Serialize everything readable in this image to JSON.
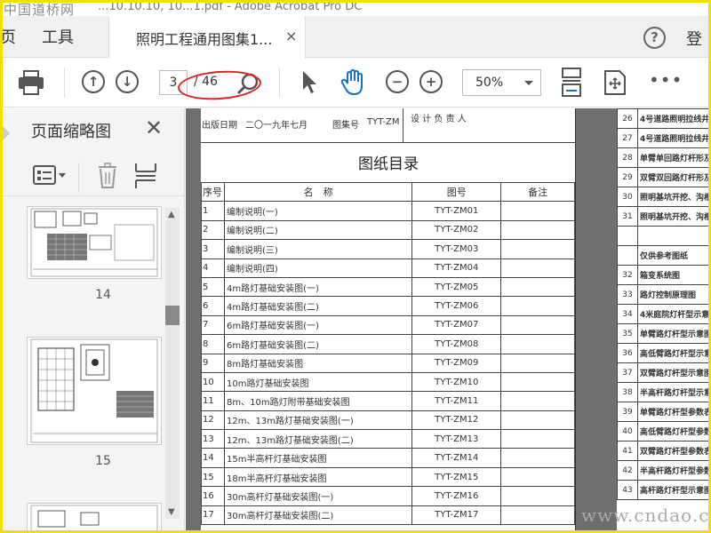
{
  "window": {
    "watermark": "中国道桥网",
    "title": "...10.10.10, 10...1.pdf - Adobe Acrobat Pro DC"
  },
  "tabbar": {
    "home_label": "页",
    "tools_label": "工具",
    "doc_tab_label": "照明工程通用图集1...",
    "close_glyph": "×",
    "help_glyph": "?",
    "login_label": "登"
  },
  "toolbar": {
    "current_page": "3",
    "total_pages": "/ 46",
    "zoom_value": "50%",
    "more_glyph": "•••"
  },
  "thumbnail_panel": {
    "title": "页面缩略图",
    "close_glyph": "✕",
    "pages": [
      "14",
      "15"
    ]
  },
  "document": {
    "header_date_label": "出版日期",
    "header_date": "二〇一九年七月",
    "header_atlas_label": "图集号",
    "header_atlas_no": "TYT-ZM",
    "header_designer": "设 计 负 责 人",
    "title": "图纸目录",
    "columns": [
      "序号",
      "名　称",
      "图号",
      "备注"
    ],
    "rows": [
      {
        "no": "1",
        "name": "编制说明(一)",
        "code": "TYT-ZM01"
      },
      {
        "no": "2",
        "name": "编制说明(二)",
        "code": "TYT-ZM02"
      },
      {
        "no": "3",
        "name": "编制说明(三)",
        "code": "TYT-ZM03"
      },
      {
        "no": "4",
        "name": "编制说明(四)",
        "code": "TYT-ZM04"
      },
      {
        "no": "5",
        "name": "4m路灯基础安装图(一)",
        "code": "TYT-ZM05"
      },
      {
        "no": "6",
        "name": "4m路灯基础安装图(二)",
        "code": "TYT-ZM06"
      },
      {
        "no": "7",
        "name": "6m路灯基础安装图(一)",
        "code": "TYT-ZM07"
      },
      {
        "no": "8",
        "name": "6m路灯基础安装图(二)",
        "code": "TYT-ZM08"
      },
      {
        "no": "9",
        "name": "8m路灯基础安装图",
        "code": "TYT-ZM09"
      },
      {
        "no": "10",
        "name": "10m路灯基础安装图",
        "code": "TYT-ZM10"
      },
      {
        "no": "11",
        "name": "8m、10m路灯附带基础安装图",
        "code": "TYT-ZM11"
      },
      {
        "no": "12",
        "name": "12m、13m路灯基础安装图(一)",
        "code": "TYT-ZM12"
      },
      {
        "no": "13",
        "name": "12m、13m路灯基础安装图(二)",
        "code": "TYT-ZM13"
      },
      {
        "no": "14",
        "name": "15m半高杆灯基础安装图",
        "code": "TYT-ZM14"
      },
      {
        "no": "15",
        "name": "18m半高杆灯基础安装图",
        "code": "TYT-ZM15"
      },
      {
        "no": "16",
        "name": "30m高杆灯基础安装图(一)",
        "code": "TYT-ZM16"
      },
      {
        "no": "17",
        "name": "30m高杆灯基础安装图(二)",
        "code": "TYT-ZM17"
      }
    ],
    "right_rows": [
      {
        "no": "26",
        "name": "4号道路照明拉线井"
      },
      {
        "no": "27",
        "name": "4号道路照明拉线井"
      },
      {
        "no": "28",
        "name": "单臂单回路灯杆形及"
      },
      {
        "no": "29",
        "name": "双臂双回路灯杆形及"
      },
      {
        "no": "30",
        "name": "照明基坑开挖、沟槽"
      },
      {
        "no": "31",
        "name": "照明基坑开挖、沟槽"
      },
      {
        "no": "",
        "name": ""
      },
      {
        "no": "",
        "name": "仅供参考图纸"
      },
      {
        "no": "32",
        "name": "箱变系统图"
      },
      {
        "no": "33",
        "name": "路灯控制原理图"
      },
      {
        "no": "34",
        "name": "4米庭院灯杆型示意"
      },
      {
        "no": "35",
        "name": "单臂路灯杆型示意图"
      },
      {
        "no": "36",
        "name": "高低臂路灯杆型示意"
      },
      {
        "no": "37",
        "name": "双臂路灯杆型示意图"
      },
      {
        "no": "38",
        "name": "半高杆路灯杆型示意"
      },
      {
        "no": "39",
        "name": "单臂路灯杆型参数表"
      },
      {
        "no": "40",
        "name": "高低臂路灯杆型参数"
      },
      {
        "no": "41",
        "name": "双臂路灯杆型参数表"
      },
      {
        "no": "42",
        "name": "半高杆路灯杆型参数"
      },
      {
        "no": "43",
        "name": "高杆路灯杆型示意图"
      }
    ]
  },
  "site_watermark": "www.cndao.com"
}
